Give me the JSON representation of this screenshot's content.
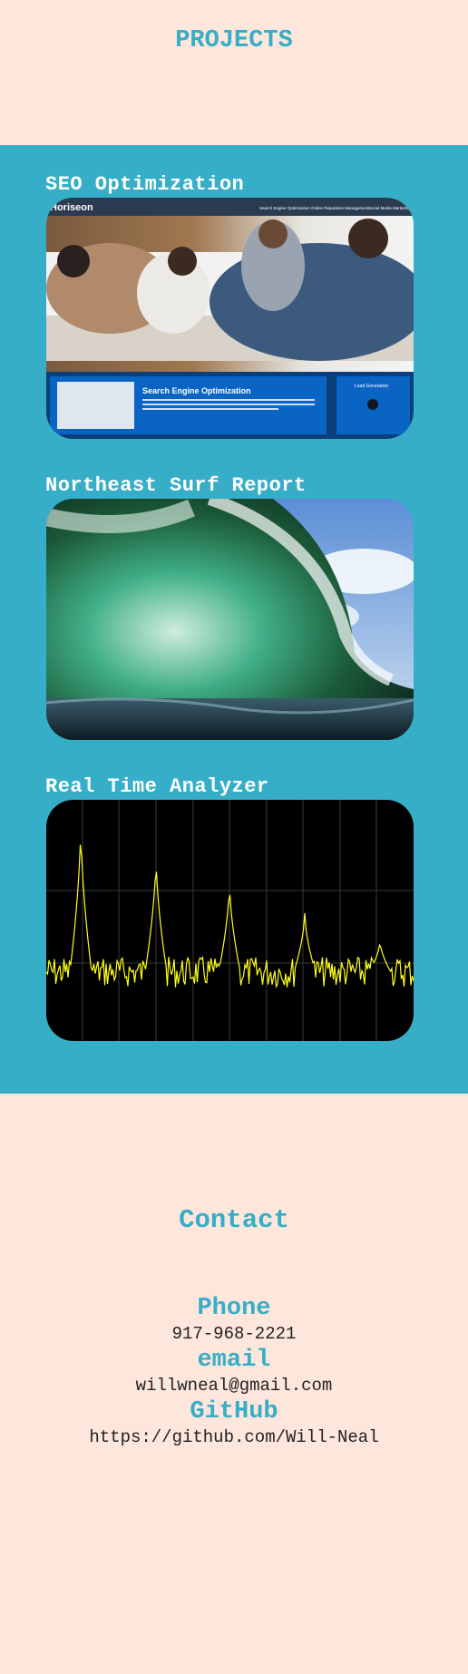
{
  "page": {
    "title": "PROJECTS"
  },
  "projects": [
    {
      "title": "SEO Optimization",
      "image": "seo-website-screenshot"
    },
    {
      "title": "Northeast Surf Report",
      "image": "ocean-wave-photo"
    },
    {
      "title": "Real Time Analyzer",
      "image": "spectrum-analyzer-display"
    }
  ],
  "seo_screenshot": {
    "brand": "Horiseon",
    "nav": [
      "Search Engine Optimization",
      "Online Reputation Management",
      "Social Media Marketing"
    ],
    "banner_title": "Search Engine Optimization",
    "sidebar_title": "Lead Generation"
  },
  "contact": {
    "title": "Contact",
    "phone_label": "Phone",
    "phone": "917-968-2221",
    "email_label": "email",
    "email": "willwneal@gmail.com",
    "github_label": "GitHub",
    "github": "https://github.com/Will-Neal"
  },
  "colors": {
    "accent": "#37aec8",
    "background": "#fde6dc",
    "spectrum": "#ffff1a"
  }
}
